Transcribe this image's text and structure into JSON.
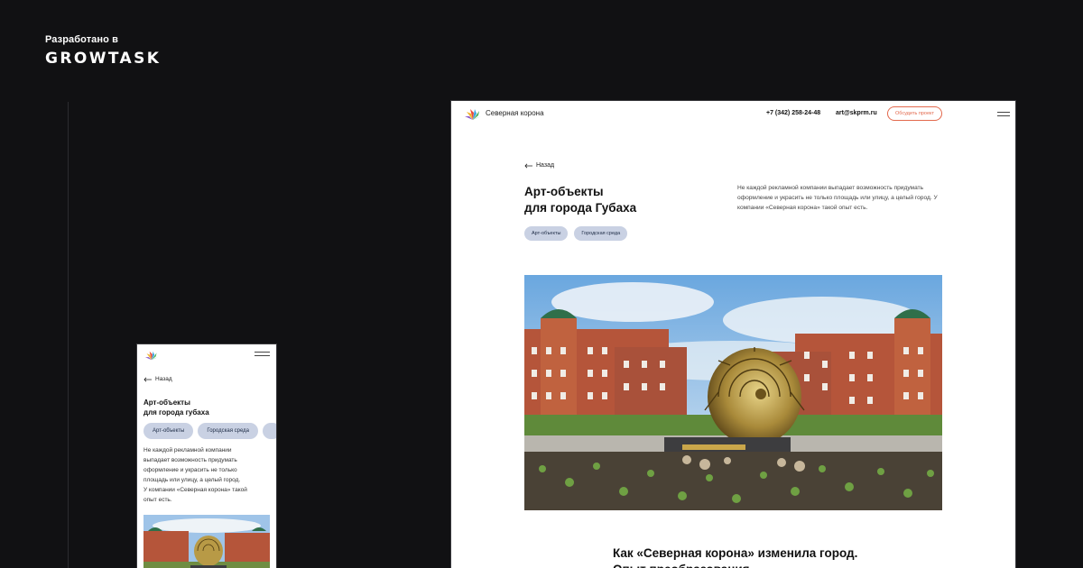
{
  "brand": {
    "caption": "Разработано в",
    "logo_text": "GROWTASK"
  },
  "desktop": {
    "header": {
      "site_name": "Северная корона",
      "phone": "+7 (342) 258-24-48",
      "email": "art@skprm.ru",
      "cta_label": "Обсудить проект",
      "menu_icon": "hamburger-icon"
    },
    "back_label": "Назад",
    "title_line1": "Арт-объекты",
    "title_line2": "для города Губаха",
    "description": "Не каждой рекламной компании выпадает возможность придумать оформление и украсить не только площадь или улицу, а целый город. У компании «Северная корона» такой опыт есть.",
    "tags": [
      "Арт-объекты",
      "Городская среда"
    ],
    "subheading": "Как «Северная корона» изменила город. Опыт преобразования"
  },
  "mobile": {
    "back_label": "Назад",
    "title_line1": "Арт-объекты",
    "title_line2": "для города губаха",
    "tags": [
      "Арт-объекты",
      "Городская среда",
      ""
    ],
    "desc_lines": [
      "Не каждой рекламной компании",
      "выпадает возможность придумать",
      "оформление и украсить не только",
      "площадь или улицу, а целый город.",
      "У компании «Северная корона» такой",
      "опыт есть."
    ]
  },
  "colors": {
    "background": "#111113",
    "accent": "#e36a4e",
    "tag_bg": "#c9d1e3",
    "brick": "#b5553a"
  }
}
